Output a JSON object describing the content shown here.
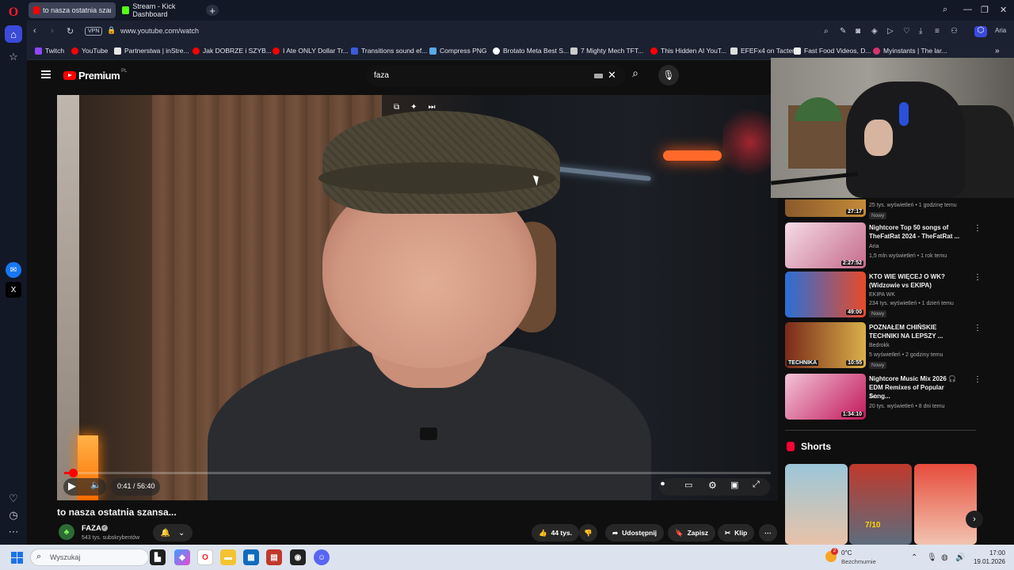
{
  "tabs": [
    {
      "label": "to nasza ostatnia szansa...",
      "active": true,
      "favicon_color": "#ff0000"
    },
    {
      "label": "Stream - Kick Dashboard",
      "active": false,
      "favicon_color": "#53fc18"
    }
  ],
  "address": {
    "vpn": "VPN",
    "url": "www.youtube.com/watch"
  },
  "bookmarks": [
    {
      "label": "Twitch",
      "color": "#9146ff"
    },
    {
      "label": "YouTube",
      "color": "#ff0000"
    },
    {
      "label": "Partnerstwa | inStre...",
      "color": "#e6e6e6"
    },
    {
      "label": "Jak DOBRZE i SZYB...",
      "color": "#ff0000"
    },
    {
      "label": "I Ate ONLY Dollar Tr...",
      "color": "#ff0000"
    },
    {
      "label": "Transitions sound ef...",
      "color": "#3b5bdb"
    },
    {
      "label": "Compress PNG",
      "color": "#5aa9e6"
    },
    {
      "label": "Brotato Meta Best S...",
      "color": "#ffffff"
    },
    {
      "label": "7 Mighty Mech TFT...",
      "color": "#cccccc"
    },
    {
      "label": "This Hidden AI YouT...",
      "color": "#ff0000"
    },
    {
      "label": "EFEFx4 on Tacter",
      "color": "#dddddd"
    },
    {
      "label": "Fast Food Videos, D...",
      "color": "#eeeeee"
    },
    {
      "label": "Myinstants | The lar...",
      "color": "#d6336c"
    }
  ],
  "youtube": {
    "logo_text": "Premium",
    "region": "PL",
    "search_value": "faza"
  },
  "player": {
    "time": "0:41 / 56:40",
    "progress_fraction": 0.012
  },
  "video": {
    "title": "to nasza ostatnia szansa...",
    "channel": "FAZA",
    "subscribers": "543 tys. subskrybentów",
    "likes": "44 tys.",
    "share_label": "Udostępnij",
    "save_label": "Zapisz",
    "clip_label": "Klip"
  },
  "recommendations": [
    {
      "title": "",
      "channel": "",
      "meta": "25 tys. wyświetleń • 1 godzinę temu",
      "duration": "27:17",
      "badge": "Nowy",
      "thumb": "#8a5a2b",
      "thumb2": "#c48a3a"
    },
    {
      "title": "Nightcore Top 50 songs of TheFatRat 2024 - TheFatRat ...",
      "channel": "Aria",
      "meta": "1,5 mln wyświetleń • 1 rok temu",
      "duration": "2:27:52",
      "badge": "",
      "thumb": "#e8c9d8",
      "thumb2": "#b34a6b"
    },
    {
      "title": "KTO WIE WIĘCEJ O WK? (Widzowie vs EKIPA)",
      "channel": "EKIPA WK",
      "meta": "234 tys. wyświetleń • 1 dzień temu",
      "duration": "49:00",
      "badge": "Nowy",
      "thumb": "#2a6fd6",
      "thumb2": "#e84a2a"
    },
    {
      "title": "POZNAŁEM CHIŃSKIE TECHNIKI NA LEPSZY ...",
      "channel": "Bedrokk",
      "meta": "5 wyświetleń • 2 godziny temu",
      "duration": "10:55",
      "badge": "Nowy",
      "thumb": "#7a2a1a",
      "thumb2": "#d9b04a",
      "overlay": "TECHNIKA"
    },
    {
      "title": "Nightcore Music Mix 2026 🎧 EDM Remixes of Popular Song...",
      "channel": "Aria",
      "meta": "20 tys. wyświetleń • 8 dni temu",
      "duration": "1:34:10",
      "badge": "",
      "thumb": "#f2c3d6",
      "thumb2": "#c2185b"
    }
  ],
  "shorts": {
    "heading": "Shorts",
    "items": [
      {
        "colors": [
          "#9cc7d9",
          "#e8c2a8"
        ],
        "label": ""
      },
      {
        "colors": [
          "#c0392b",
          "#5d6d7e"
        ],
        "label": "7/10"
      },
      {
        "colors": [
          "#e74c3c",
          "#f1c4b0"
        ],
        "label": ""
      }
    ]
  },
  "taskbar": {
    "search_placeholder": "Wyszukaj",
    "weather_temp": "0°C",
    "weather_desc": "Bezchmurnie",
    "notification_count": "2",
    "time": "17:00",
    "date": "19.01.2026"
  }
}
